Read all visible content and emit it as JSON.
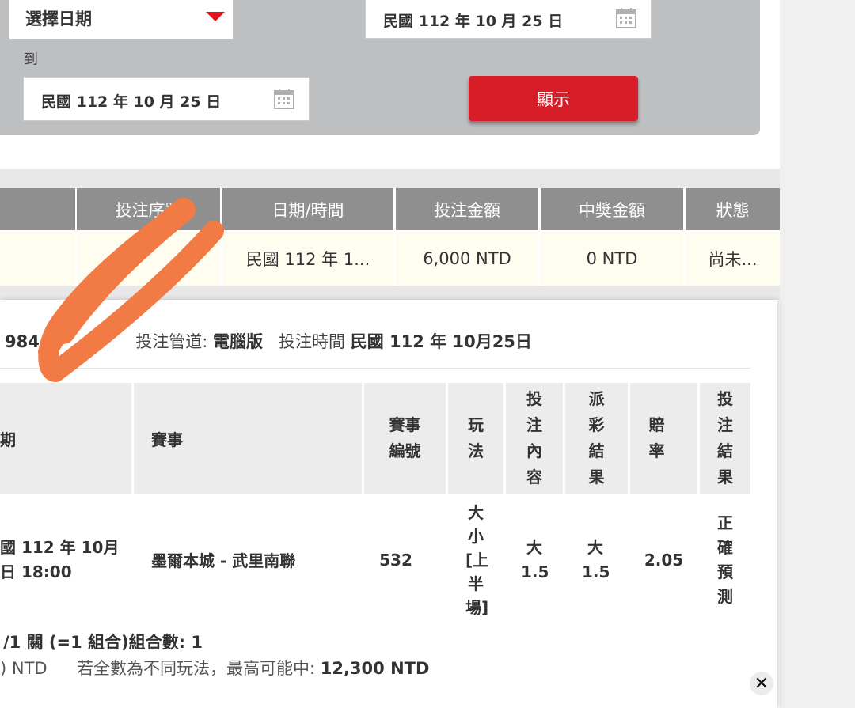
{
  "filter": {
    "date_select_label": "選擇日期",
    "date_from_value": "民國 112 年 10 月 25 日",
    "to_label": "到",
    "date_to_value": "民國 112 年 10 月 25 日",
    "show_button": "顯示"
  },
  "summary": {
    "headers": [
      "投注序號",
      "日期/時間",
      "投注金額",
      "中獎金額",
      "狀態"
    ],
    "row": {
      "bet_no": "",
      "datetime": "民國 112 年 1...",
      "amount": "6,000 NTD",
      "prize": "0 NTD",
      "status": "尚未..."
    }
  },
  "detail": {
    "info": {
      "bet_no_fragment": "984",
      "channel_label": "投注管道:",
      "channel_value": "電腦版",
      "time_label": "投注時間",
      "time_value": "民國 112 年 10月25日"
    },
    "headers": {
      "date": "期",
      "event": "賽事",
      "event_no": "賽事編號",
      "play": "玩法",
      "bet_content": "投注內容",
      "result": "派彩結果",
      "odds": "賠率",
      "bet_result": "投注結果"
    },
    "row": {
      "date_line1": "國 112 年 10月",
      "date_line2": "日 18:00",
      "event": "墨爾本城 - 武里南聯",
      "event_no": "532",
      "play": "大小[上半場]",
      "bet_content": "大1.5",
      "result": "大1.5",
      "odds": "2.05",
      "bet_result": "正確預測"
    },
    "footer": {
      "combo": "/1 關 (=1 組合)組合數: 1",
      "stake_fragment": ") NTD",
      "max_label": "若全數為不同玩法，最高可能中:",
      "max_value": "12,300 NTD"
    }
  },
  "icons": {
    "calendar": "calendar-icon",
    "close": "close-icon",
    "caret": "caret-down-icon"
  },
  "colors": {
    "accent": "#d71e28",
    "panel": "#bebfc1",
    "header": "#8f8f8f",
    "row_bg": "#fefdf0",
    "scribble": "#f27a45"
  }
}
